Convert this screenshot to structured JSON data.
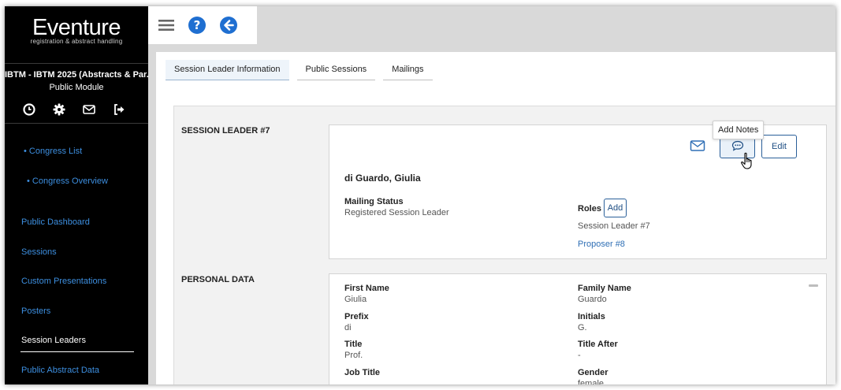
{
  "brand": {
    "name": "Eventure",
    "tagline": "registration & abstract handling"
  },
  "module": {
    "title": "IBTM - IBTM 2025 (Abstracts & Par...",
    "subtitle": "Public Module"
  },
  "sidebar_icons": [
    "clock-icon",
    "gear-icon",
    "envelope-icon",
    "sign-out-icon"
  ],
  "sidebar": {
    "sub_links": [
      "• Congress List",
      "• Congress Overview"
    ],
    "links": [
      "Public Dashboard",
      "Sessions",
      "Custom Presentations",
      "Posters"
    ],
    "active": "Session Leaders",
    "after": "Public Abstract Data"
  },
  "toolbar_icons": [
    "menu-icon",
    "help-icon",
    "back-arrow-icon"
  ],
  "tabs": [
    {
      "label": "Session Leader Information",
      "active": true
    },
    {
      "label": "Public Sessions",
      "active": false
    },
    {
      "label": "Mailings",
      "active": false
    }
  ],
  "leader_section": {
    "label": "SESSION LEADER #7",
    "tooltip": "Add Notes",
    "edit_label": "Edit",
    "name": "di Guardo, Giulia",
    "mailing_status_label": "Mailing Status",
    "mailing_status_value": "Registered Session Leader",
    "roles_label": "Roles",
    "roles_add_label": "Add",
    "roles": [
      "Session Leader #7"
    ],
    "proposer_link": "Proposer #8"
  },
  "personal_section": {
    "label": "PERSONAL DATA",
    "fields": {
      "first_name": {
        "label": "First Name",
        "value": "Giulia"
      },
      "family_name": {
        "label": "Family Name",
        "value": "Guardo"
      },
      "prefix": {
        "label": "Prefix",
        "value": "di"
      },
      "initials": {
        "label": "Initials",
        "value": "G."
      },
      "title": {
        "label": "Title",
        "value": "Prof."
      },
      "title_after": {
        "label": "Title After",
        "value": "-"
      },
      "job_title": {
        "label": "Job Title",
        "value": ""
      },
      "gender": {
        "label": "Gender",
        "value": "female"
      }
    }
  },
  "colors": {
    "sidebar_bg": "#000000",
    "link_blue": "#3d8fe0",
    "accent": "#1f6fd1"
  }
}
